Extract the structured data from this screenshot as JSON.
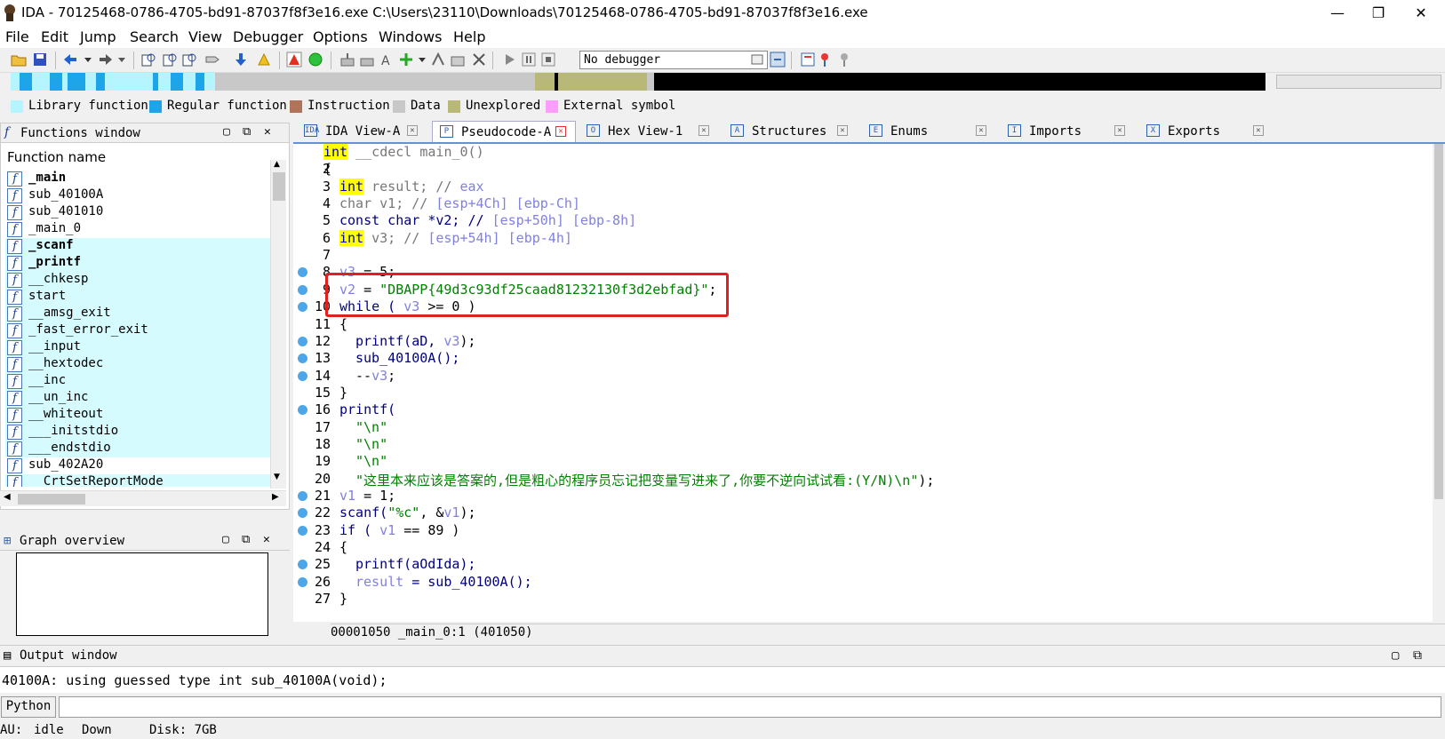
{
  "window": {
    "title": "IDA - 70125468-0786-4705-bd91-87037f8f3e16.exe C:\\Users\\23110\\Downloads\\70125468-0786-4705-bd91-87037f8f3e16.exe",
    "minimize": "—",
    "restore": "❐",
    "close": "✕"
  },
  "menu": [
    "File",
    "Edit",
    "Jump",
    "Search",
    "View",
    "Debugger",
    "Options",
    "Windows",
    "Help"
  ],
  "toolbar": {
    "debugger": "No debugger"
  },
  "legend": [
    {
      "label": "Library function",
      "color": "#b5f5ff"
    },
    {
      "label": "Regular function",
      "color": "#1ea5e9"
    },
    {
      "label": "Instruction",
      "color": "#b0745a"
    },
    {
      "label": "Data",
      "color": "#c8c8c8"
    },
    {
      "label": "Unexplored",
      "color": "#b8b878"
    },
    {
      "label": "External symbol",
      "color": "#ff9cff"
    }
  ],
  "functions_window": {
    "title": "Functions window",
    "header": "Function name",
    "items": [
      {
        "name": "_main",
        "bold": true,
        "lib": false
      },
      {
        "name": "sub_40100A",
        "bold": false,
        "lib": false
      },
      {
        "name": "sub_401010",
        "bold": false,
        "lib": false
      },
      {
        "name": "_main_0",
        "bold": false,
        "lib": false
      },
      {
        "name": "_scanf",
        "bold": true,
        "lib": true
      },
      {
        "name": "_printf",
        "bold": true,
        "lib": true
      },
      {
        "name": "__chkesp",
        "bold": false,
        "lib": true
      },
      {
        "name": "start",
        "bold": false,
        "lib": true
      },
      {
        "name": "__amsg_exit",
        "bold": false,
        "lib": true
      },
      {
        "name": "_fast_error_exit",
        "bold": false,
        "lib": true
      },
      {
        "name": "__input",
        "bold": false,
        "lib": true
      },
      {
        "name": "__hextodec",
        "bold": false,
        "lib": true
      },
      {
        "name": "__inc",
        "bold": false,
        "lib": true
      },
      {
        "name": "__un_inc",
        "bold": false,
        "lib": true
      },
      {
        "name": "__whiteout",
        "bold": false,
        "lib": true
      },
      {
        "name": "___initstdio",
        "bold": false,
        "lib": true
      },
      {
        "name": "___endstdio",
        "bold": false,
        "lib": true
      },
      {
        "name": "sub_402A20",
        "bold": false,
        "lib": false
      },
      {
        "name": "__CrtSetReportMode",
        "bold": false,
        "lib": true
      }
    ]
  },
  "graph_overview": {
    "title": "Graph overview"
  },
  "tabs": [
    {
      "label": "IDA View-A",
      "icon": "IDA"
    },
    {
      "label": "Pseudocode-A",
      "icon": "P"
    },
    {
      "label": "Hex View-1",
      "icon": "O"
    },
    {
      "label": "Structures",
      "icon": "A"
    },
    {
      "label": "Enums",
      "icon": "E"
    },
    {
      "label": "Imports",
      "icon": "I"
    },
    {
      "label": "Exports",
      "icon": "X"
    }
  ],
  "code": {
    "lines": [
      {
        "n": "1",
        "dot": false
      },
      {
        "n": "2",
        "dot": false
      },
      {
        "n": "3",
        "dot": false
      },
      {
        "n": "4",
        "dot": false
      },
      {
        "n": "5",
        "dot": false
      },
      {
        "n": "6",
        "dot": false
      },
      {
        "n": "7",
        "dot": false
      },
      {
        "n": "8",
        "dot": true
      },
      {
        "n": "9",
        "dot": true
      },
      {
        "n": "10",
        "dot": true
      },
      {
        "n": "11",
        "dot": false
      },
      {
        "n": "12",
        "dot": true
      },
      {
        "n": "13",
        "dot": true
      },
      {
        "n": "14",
        "dot": true
      },
      {
        "n": "15",
        "dot": false
      },
      {
        "n": "16",
        "dot": true
      },
      {
        "n": "17",
        "dot": false
      },
      {
        "n": "18",
        "dot": false
      },
      {
        "n": "19",
        "dot": false
      },
      {
        "n": "20",
        "dot": false
      },
      {
        "n": "21",
        "dot": true
      },
      {
        "n": "22",
        "dot": true
      },
      {
        "n": "23",
        "dot": true
      },
      {
        "n": "24",
        "dot": false
      },
      {
        "n": "25",
        "dot": true
      },
      {
        "n": "26",
        "dot": true
      },
      {
        "n": "27",
        "dot": false
      }
    ],
    "t": {
      "int": "int",
      "l1": " __cdecl main_0()",
      "l2": "{",
      "l3a": " result; // ",
      "l3b": "eax",
      "l4a": "char v1; // ",
      "l4b": "[esp+4Ch] [ebp-Ch]",
      "l5a": "const char *v2; // ",
      "l5b": "[esp+50h] [ebp-8h]",
      "l6a": " v3; // ",
      "l6b": "[esp+54h] [ebp-4h]",
      "l8a": "v3",
      "l8b": " = 5;",
      "l9a": "v2",
      "l9b": " = ",
      "l9c": "\"DBAPP{49d3c93df25caad81232130f3d2ebfad}\"",
      "l9d": ";",
      "l10a": "while ( ",
      "l10b": "v3",
      "l10c": " >= 0 )",
      "l11": "{",
      "l12a": "printf(aD, ",
      "l12b": "v3",
      "l12c": ");",
      "l13": "sub_40100A();",
      "l14a": "--",
      "l14b": "v3",
      "l14c": ";",
      "l15": "}",
      "l16": "printf(",
      "l17": "\"\\n\"",
      "l18": "\"\\n\"",
      "l19": "\"\\n\"",
      "l20a": "\"这里本来应该是答案的,但是粗心的程序员忘记把变量写进来了,你要不逆向试试看:(Y/N)\\n\"",
      "l20b": ");",
      "l21a": "v1",
      "l21b": " = 1;",
      "l22a": "scanf(",
      "l22b": "\"%c\"",
      "l22c": ", &",
      "l22d": "v1",
      "l22e": ");",
      "l23a": "if ( ",
      "l23b": "v1",
      "l23c": " == 89 )",
      "l24": "{",
      "l25": "printf(aOdIda);",
      "l26a": "result",
      "l26b": " = sub_40100A();",
      "l27": "}"
    }
  },
  "code_status": "00001050 _main_0:1 (401050)",
  "output_window": {
    "title": "Output window",
    "text": "40100A: using guessed type int sub_40100A(void);"
  },
  "python_button": "Python",
  "statusbar": {
    "au_label": "AU:",
    "au_value": "idle",
    "dir": "Down",
    "disk": "Disk: 7GB"
  }
}
